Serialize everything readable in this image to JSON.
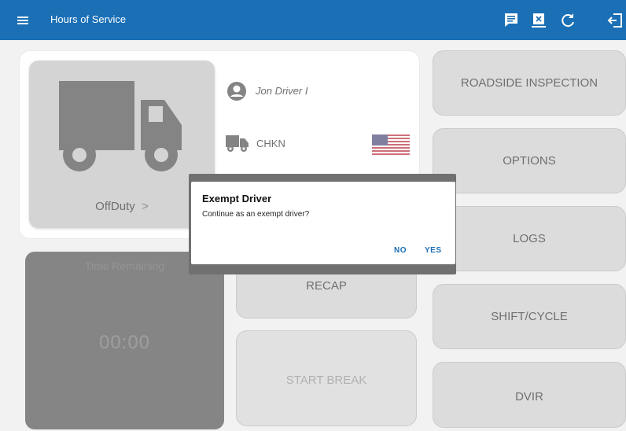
{
  "appbar": {
    "title": "Hours of Service",
    "icons": [
      "menu-icon",
      "message-icon",
      "transfer-icon",
      "refresh-icon",
      "logout-icon"
    ]
  },
  "status": {
    "label": "OffDuty",
    "chevron": ">"
  },
  "driver": {
    "name": "Jon Driver I"
  },
  "vehicle": {
    "code": "CHKN",
    "country": "US"
  },
  "time_remaining": {
    "label": "Time Remaining",
    "value": "00:00"
  },
  "center_buttons": {
    "recap": "RECAP",
    "start_break": "START BREAK"
  },
  "right_menu": {
    "roadside": "ROADSIDE INSPECTION",
    "options": "OPTIONS",
    "logs": "LOGS",
    "shift_cycle": "SHIFT/CYCLE",
    "dvir": "DVIR"
  },
  "dialog": {
    "title": "Exempt Driver",
    "message": "Continue as an exempt driver?",
    "no": "NO",
    "yes": "YES"
  },
  "colors": {
    "appbar": "#1a6fb5",
    "accent": "#1a6fb5"
  }
}
